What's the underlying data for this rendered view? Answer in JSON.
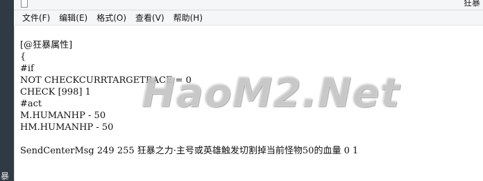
{
  "window": {
    "title": "狂暴"
  },
  "menu": {
    "items": [
      "文件(F)",
      "编辑(E)",
      "格式(O)",
      "查看(V)",
      "帮助(H)"
    ]
  },
  "left_strip": {
    "text": "暴"
  },
  "document": {
    "lines": [
      "[@狂暴属性]",
      "{",
      "#if",
      "NOT CHECKCURRTARGETRACE = 0",
      "CHECK [998] 1",
      "#act",
      "M.HUMANHP - 50",
      "HM.HUMANHP - 50",
      "",
      "SendCenterMsg 249 255 狂暴之力·主号或英雄触发切割掉当前怪物50的血量 0 1"
    ]
  },
  "watermark": {
    "text": "HaoM2.Net"
  },
  "colors": {
    "menubar_bg": "#f5f6f7",
    "editor_bg": "#ffffff",
    "text": "#111111",
    "left_strip": "#2f3a44"
  }
}
